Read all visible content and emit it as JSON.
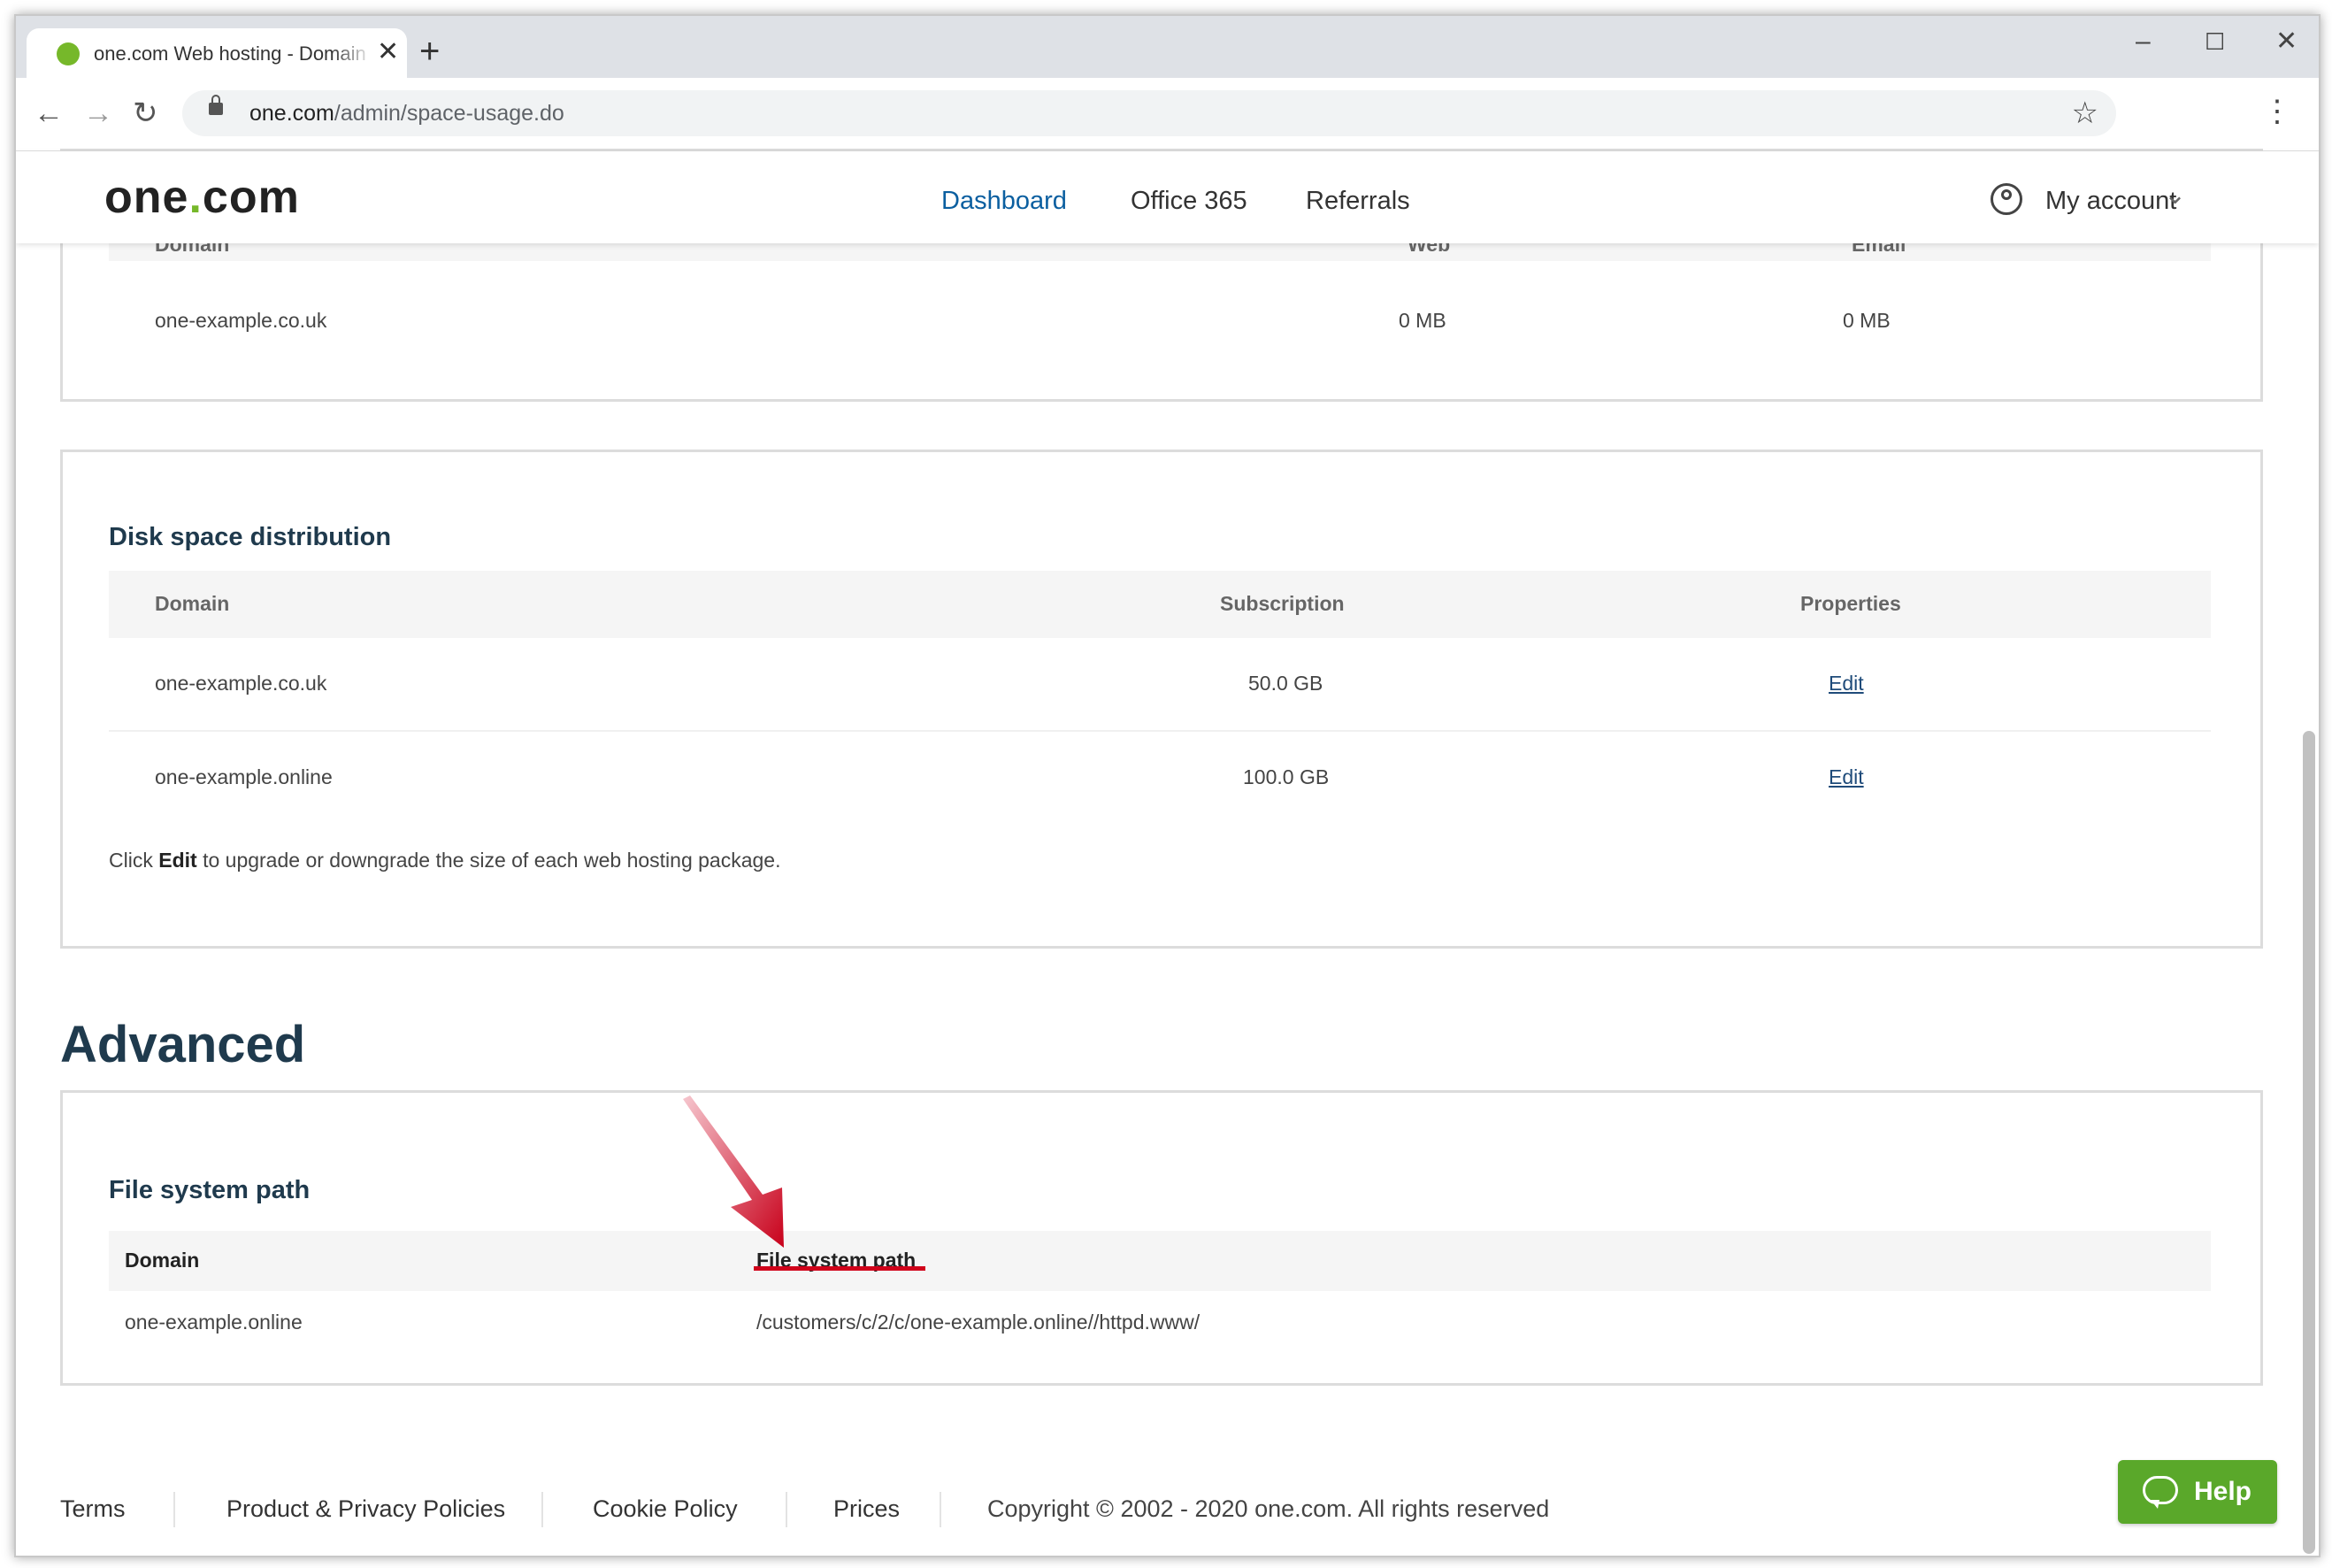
{
  "browser": {
    "tab_title": "one.com Web hosting  -  Domain",
    "url_host": "one.com",
    "url_path": "/admin/space-usage.do"
  },
  "header": {
    "logo": {
      "part1": "one",
      "dot": ".",
      "part2": "com"
    },
    "nav": [
      {
        "label": "Dashboard",
        "active": true
      },
      {
        "label": "Office 365",
        "active": false
      },
      {
        "label": "Referrals",
        "active": false
      }
    ],
    "account_label": "My account"
  },
  "usage_card": {
    "partial_headers": [
      "Domain",
      "Web",
      "Email"
    ],
    "row": {
      "domain": "one-example.co.uk",
      "web": "0 MB",
      "email": "0 MB"
    }
  },
  "disk_card": {
    "title": "Disk space distribution",
    "headers": {
      "domain": "Domain",
      "subscription": "Subscription",
      "properties": "Properties"
    },
    "rows": [
      {
        "domain": "one-example.co.uk",
        "subscription": "50.0 GB",
        "action": "Edit"
      },
      {
        "domain": "one-example.online",
        "subscription": "100.0 GB",
        "action": "Edit"
      }
    ],
    "note_prefix": "Click",
    "note_bold": "Edit",
    "note_suffix": "to upgrade or downgrade the size of each web hosting package."
  },
  "advanced": {
    "section_title": "Advanced",
    "card_title": "File system path",
    "headers": {
      "domain": "Domain",
      "path": "File system path"
    },
    "row": {
      "domain": "one-example.online",
      "path": "/customers/c/2/c/one-example.online//httpd.www/"
    }
  },
  "footer": {
    "links": [
      "Terms",
      "Product & Privacy Policies",
      "Cookie Policy",
      "Prices"
    ],
    "copyright": "Copyright © 2002 - 2020 one.com. All rights reserved"
  },
  "help_label": "Help",
  "colors": {
    "accent_green": "#76b82a",
    "nav_active": "#0b5fa0",
    "heading": "#1f3a4d",
    "annotation_red": "#d0021b"
  }
}
